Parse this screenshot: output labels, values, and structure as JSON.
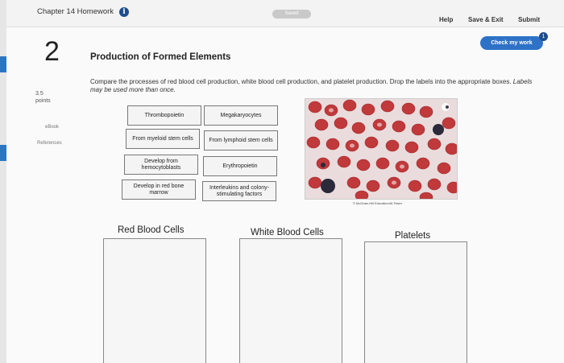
{
  "header": {
    "chapter_title": "Chapter 14 Homework",
    "info_icon": "info-icon",
    "saved_label": "Saved",
    "help_label": "Help",
    "save_exit_label": "Save & Exit",
    "submit_label": "Submit"
  },
  "check_button": {
    "label": "Check my work",
    "badge": "1"
  },
  "question": {
    "number": "2",
    "title": "Production of Formed Elements",
    "points_value": "3.5",
    "points_label": "points",
    "instructions": "Compare the processes of red blood cell production, white blood cell production, and platelet production. Drop the labels into the appropriate boxes.",
    "instructions_italic": "Labels may be used more than once."
  },
  "sidebar_links": {
    "ebook": "eBook",
    "references": "References"
  },
  "labels": [
    "Thrombopoietin",
    "Megakaryocytes",
    "From myeloid stem cells",
    "From lymphoid stem cells",
    "Develop from hemocytoblasts",
    "Erythropoietin",
    "Develop in red bone marrow",
    "Interleukins and colony-stimulating factors"
  ],
  "image_credit": "© McGraw-Hill Education/Al Telser",
  "categories": [
    "Red Blood Cells",
    "White Blood Cells",
    "Platelets"
  ],
  "colors": {
    "accent_blue": "#2e72c7",
    "dark_blue": "#1f4d8c",
    "rbc_red": "#c0393b",
    "wbc_dark": "#2a2a3a"
  }
}
